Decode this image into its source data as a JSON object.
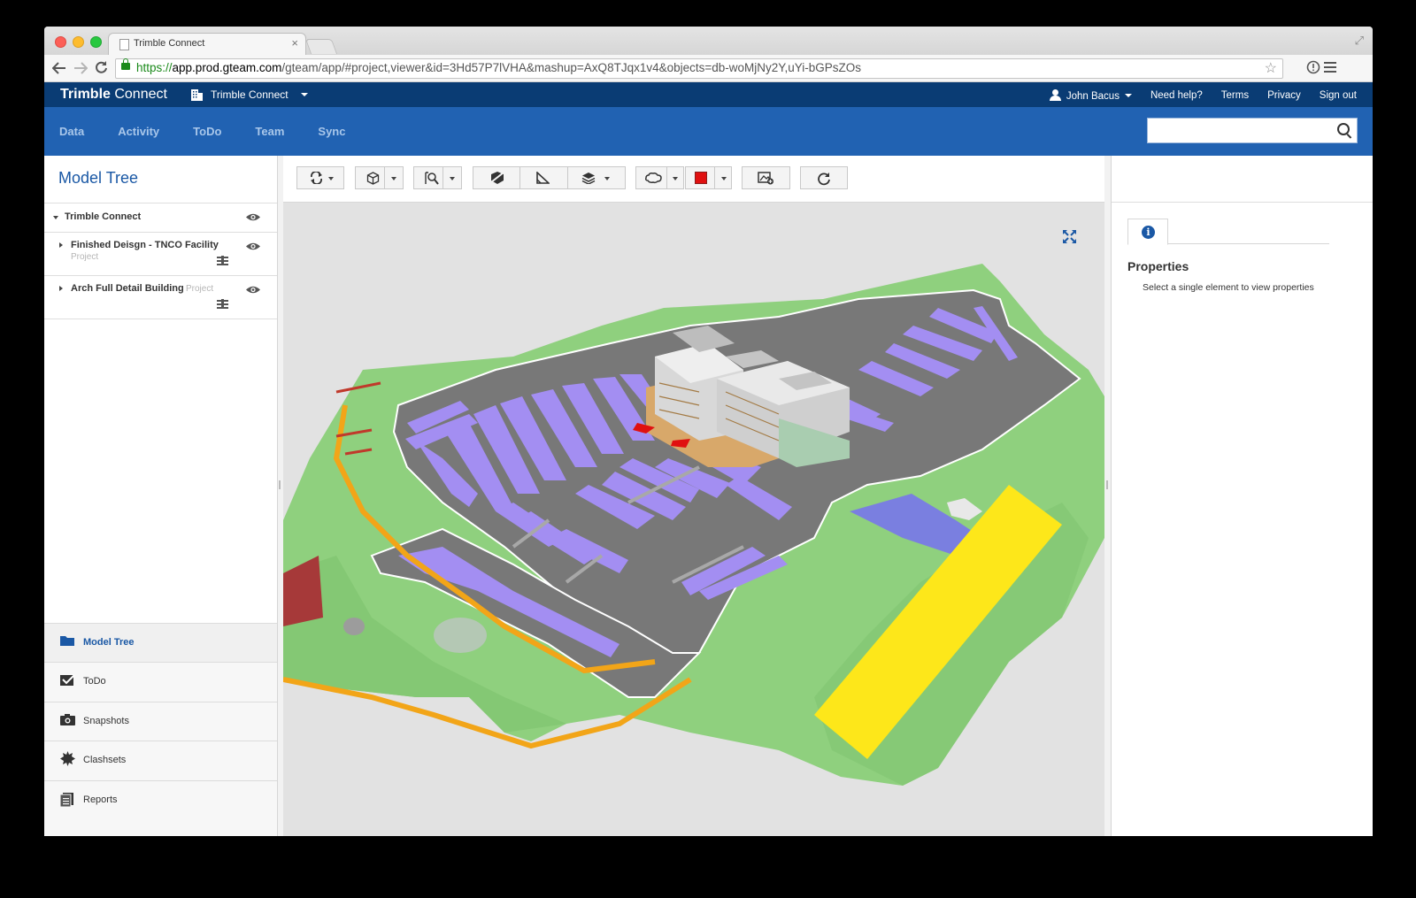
{
  "browser": {
    "tab_title": "Trimble Connect",
    "tab_close": "×",
    "url_scheme": "https://",
    "url_host": "app.prod.gteam.com",
    "url_path": "/gteam/app/#project,viewer&id=3Hd57P7lVHA&mashup=AxQ8TJqx1v4&objects=db-woMjNy2Y,uYi-bGPsZOs"
  },
  "header": {
    "brand_bold": "Trimble",
    "brand_light": " Connect",
    "project_selector": "Trimble Connect",
    "user_name": "John Bacus",
    "links": [
      "Need help?",
      "Terms",
      "Privacy",
      "Sign out"
    ]
  },
  "nav": {
    "items": [
      "Data",
      "Activity",
      "ToDo",
      "Team",
      "Sync"
    ],
    "search_placeholder": ""
  },
  "left_panel": {
    "title": "Model Tree",
    "root": "Trimble Connect",
    "items": [
      {
        "name": "Finished Deisgn - TNCO Facility",
        "type": "Project"
      },
      {
        "name": "Arch Full Detail Building",
        "type": "Project"
      }
    ],
    "bottom_nav": [
      "Model Tree",
      "ToDo",
      "Snapshots",
      "Clashsets",
      "Reports"
    ]
  },
  "viewer": {
    "toolbar_icons": [
      "rotate-icon",
      "cube-view-icon",
      "zoom-select-icon",
      "section-icon",
      "measure-icon",
      "layers-icon",
      "markup-cloud-icon",
      "color-swatch-icon",
      "snapshot-icon",
      "refresh-icon"
    ],
    "markup_color": "#e01010",
    "scene_colors": {
      "ground": "#8fd07e",
      "asphalt": "#787878",
      "parking": "#a38ef2",
      "field": "#fde71a",
      "path": "#f2a518",
      "building": "#d8d8d8"
    }
  },
  "right_panel": {
    "info_tab_glyph": "i",
    "title": "Properties",
    "hint": "Select a single element to view properties"
  }
}
